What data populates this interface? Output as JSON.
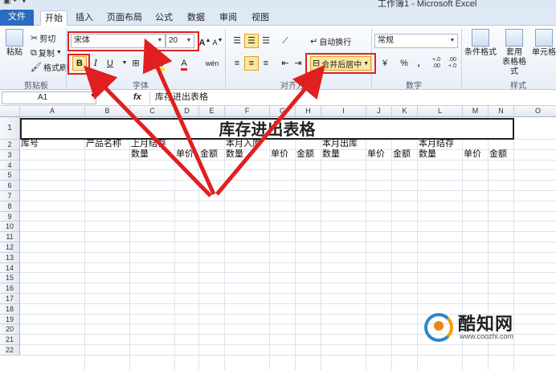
{
  "window": {
    "title": "工作簿1 - Microsoft Excel",
    "quick_access": "▣ ↶ ▾"
  },
  "tabs": [
    {
      "label": "文件"
    },
    {
      "label": "开始"
    },
    {
      "label": "插入"
    },
    {
      "label": "页面布局"
    },
    {
      "label": "公式"
    },
    {
      "label": "数据"
    },
    {
      "label": "审阅"
    },
    {
      "label": "视图"
    }
  ],
  "ribbon": {
    "clipboard": {
      "paste": "粘贴",
      "cut": "剪切",
      "copy": "复制",
      "format_painter": "格式刷",
      "group": "剪贴板"
    },
    "font": {
      "name": "宋体",
      "size": "20",
      "grow": "A",
      "shrink": "A",
      "bold": "B",
      "italic": "I",
      "underline": "U",
      "font_color_letter": "A",
      "phonetic": "wén",
      "group": "字体"
    },
    "alignment": {
      "wrap": "自动换行",
      "merge": "合并后居中",
      "group": "对齐方式"
    },
    "number": {
      "format": "常规",
      "percent": "%",
      "comma": ",",
      "inc_dec": "+.0 .00",
      "dec_dec": ".00 +.0",
      "group": "数字"
    },
    "styles": {
      "conditional": "条件格式",
      "table_l1": "套用",
      "table_l2": "表格格式",
      "cell_l1": "单元格",
      "cell_l2": "",
      "group": "样式"
    }
  },
  "formula_bar": {
    "name_box": "A1",
    "fx": "fx",
    "content": "库存进出表格"
  },
  "columns": [
    "A",
    "B",
    "C",
    "D",
    "E",
    "F",
    "G",
    "H",
    "I",
    "J",
    "K",
    "L",
    "M",
    "N",
    "O"
  ],
  "rows": [
    "1",
    "2",
    "3",
    "4",
    "5",
    "6",
    "7",
    "8",
    "9",
    "10",
    "11",
    "12",
    "13",
    "14",
    "15",
    "16",
    "17",
    "18",
    "19",
    "20",
    "21",
    "22"
  ],
  "sheet": {
    "title": "库存进出表格",
    "row2": {
      "a": "库号",
      "b": "产品名称",
      "c": "上月结存",
      "f": "本月入库",
      "i": "本月出库",
      "l": "本月结存"
    },
    "row3": {
      "c": "数量",
      "d": "单价",
      "e": "金额",
      "f": "数量",
      "g": "单价",
      "h": "金额",
      "i": "数量",
      "j": "单价",
      "k": "金额",
      "l": "数量",
      "m": "单价",
      "n": "金额"
    }
  },
  "watermark": {
    "text": "酷知网",
    "url": "www.coozhi.com"
  },
  "colors": {
    "file_tab": "#2a6cbf",
    "highlight": "#e02020",
    "accent_orange": "#f39c12"
  }
}
